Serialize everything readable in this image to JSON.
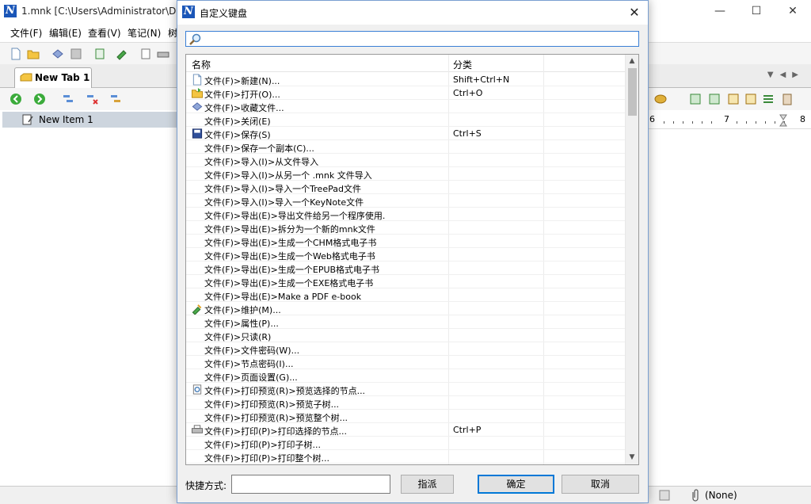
{
  "main_window": {
    "title": "1.mnk [C:\\Users\\Administrator\\Do",
    "menu": [
      "文件(F)",
      "编辑(E)",
      "查看(V)",
      "笔记(N)",
      "树"
    ],
    "tab_label": "New Tab 1",
    "tree_item": "New Item 1",
    "ruler_numbers": [
      "6",
      "7",
      "8"
    ],
    "status_attachment": "(None)"
  },
  "dialog": {
    "title": "自定义键盘",
    "search_value": "",
    "columns": {
      "name": "名称",
      "category": "分类"
    },
    "rows": [
      {
        "icon": "new-file",
        "name": "文件(F)>新建(N)...",
        "shortcut": "Shift+Ctrl+N"
      },
      {
        "icon": "open-folder",
        "name": "文件(F)>打开(O)...",
        "shortcut": "Ctrl+O"
      },
      {
        "icon": "favorites",
        "name": "文件(F)>收藏文件...",
        "shortcut": ""
      },
      {
        "icon": "",
        "name": "文件(F)>关闭(E)",
        "shortcut": ""
      },
      {
        "icon": "save",
        "name": "文件(F)>保存(S)",
        "shortcut": "Ctrl+S"
      },
      {
        "icon": "",
        "name": "文件(F)>保存一个副本(C)...",
        "shortcut": ""
      },
      {
        "icon": "",
        "name": "文件(F)>导入(I)>从文件导入",
        "shortcut": ""
      },
      {
        "icon": "",
        "name": "文件(F)>导入(I)>从另一个 .mnk 文件导入",
        "shortcut": ""
      },
      {
        "icon": "",
        "name": "文件(F)>导入(I)>导入一个TreePad文件",
        "shortcut": ""
      },
      {
        "icon": "",
        "name": "文件(F)>导入(I)>导入一个KeyNote文件",
        "shortcut": ""
      },
      {
        "icon": "",
        "name": "文件(F)>导出(E)>导出文件给另一个程序使用.",
        "shortcut": ""
      },
      {
        "icon": "",
        "name": "文件(F)>导出(E)>拆分为一个新的mnk文件",
        "shortcut": ""
      },
      {
        "icon": "",
        "name": "文件(F)>导出(E)>生成一个CHM格式电子书",
        "shortcut": ""
      },
      {
        "icon": "",
        "name": "文件(F)>导出(E)>生成一个Web格式电子书",
        "shortcut": ""
      },
      {
        "icon": "",
        "name": "文件(F)>导出(E)>生成一个EPUB格式电子书",
        "shortcut": ""
      },
      {
        "icon": "",
        "name": "文件(F)>导出(E)>生成一个EXE格式电子书",
        "shortcut": ""
      },
      {
        "icon": "",
        "name": "文件(F)>导出(E)>Make a PDF e-book",
        "shortcut": ""
      },
      {
        "icon": "maintain",
        "name": "文件(F)>维护(M)...",
        "shortcut": ""
      },
      {
        "icon": "",
        "name": "文件(F)>属性(P)...",
        "shortcut": ""
      },
      {
        "icon": "",
        "name": "文件(F)>只读(R)",
        "shortcut": ""
      },
      {
        "icon": "",
        "name": "文件(F)>文件密码(W)...",
        "shortcut": ""
      },
      {
        "icon": "",
        "name": "文件(F)>节点密码(I)...",
        "shortcut": ""
      },
      {
        "icon": "",
        "name": "文件(F)>页面设置(G)...",
        "shortcut": ""
      },
      {
        "icon": "print-preview",
        "name": "文件(F)>打印预览(R)>预览选择的节点...",
        "shortcut": ""
      },
      {
        "icon": "",
        "name": "文件(F)>打印预览(R)>预览子树...",
        "shortcut": ""
      },
      {
        "icon": "",
        "name": "文件(F)>打印预览(R)>预览整个树...",
        "shortcut": ""
      },
      {
        "icon": "printer",
        "name": "文件(F)>打印(P)>打印选择的节点...",
        "shortcut": "Ctrl+P"
      },
      {
        "icon": "",
        "name": "文件(F)>打印(P)>打印子树...",
        "shortcut": ""
      },
      {
        "icon": "",
        "name": "文件(F)>打印(P)>打印整个树...",
        "shortcut": ""
      }
    ],
    "shortcut_label": "快捷方式:",
    "shortcut_value": "",
    "assign_button": "指派",
    "ok_button": "确定",
    "cancel_button": "取消"
  },
  "colors": {
    "accent": "#0078d7",
    "logo_blue": "#1a56b8",
    "selection": "#cdd5de"
  }
}
